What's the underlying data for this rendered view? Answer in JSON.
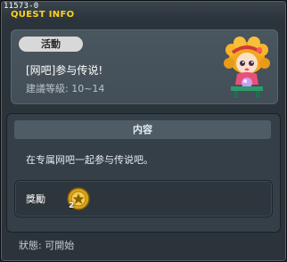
{
  "window": {
    "quest_id": "11573-0",
    "header_title": "QUEST INFO"
  },
  "quest": {
    "type_badge": "活動",
    "title": "[网吧]参与传说!",
    "level_range": "建議等級: 10~14"
  },
  "content": {
    "header": "内容",
    "description": "在专属网吧一起参与传说吧。"
  },
  "reward": {
    "label": "獎勵",
    "item_icon": "gold-medal-coin-icon",
    "item_count": "2"
  },
  "status": {
    "text": "狀態: 可開始"
  },
  "colors": {
    "title_yellow": "#ffd21a",
    "panel": "#434e57",
    "background": "#2b343b"
  }
}
